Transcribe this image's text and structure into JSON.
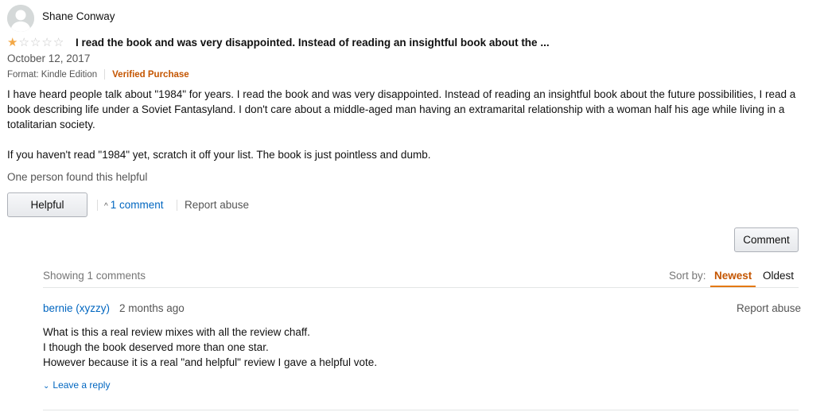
{
  "review": {
    "reviewer_name": "Shane Conway",
    "rating": 1,
    "rating_max": 5,
    "title": "I read the book and was very disappointed. Instead of reading an insightful book about the ...",
    "date": "October 12, 2017",
    "format": "Format: Kindle Edition",
    "verified": "Verified Purchase",
    "body_paragraphs": [
      "I have heard people talk about \"1984\" for years. I read the book and was very disappointed. Instead of reading an insightful book about the future possibilities, I read a book describing life under a Soviet Fantasyland. I don't care about a middle-aged man having an extramarital relationship with a woman half his age while living in a totalitarian society.",
      "If you haven't read \"1984\" yet, scratch it off your list. The book is just pointless and dumb."
    ],
    "helpful_count": "One person found this helpful",
    "helpful_button": "Helpful",
    "comments_link": "1 comment",
    "report_abuse": "Report abuse"
  },
  "comments_section": {
    "comment_button": "Comment",
    "showing": "Showing 1 comments",
    "sort_label": "Sort by:",
    "sort_newest": "Newest",
    "sort_oldest": "Oldest",
    "comments": [
      {
        "author": "bernie (xyzzy)",
        "time": "2 months ago",
        "report_abuse": "Report abuse",
        "lines": [
          "What is this a real review mixes with all the review chaff.",
          "I though the book deserved more than one star.",
          "However because it is a real \"and helpful\" review I gave a helpful vote."
        ],
        "reply": "Leave a reply"
      }
    ]
  },
  "colors": {
    "link": "#0066c0",
    "accent_orange": "#c45500",
    "star": "#f3a847"
  }
}
